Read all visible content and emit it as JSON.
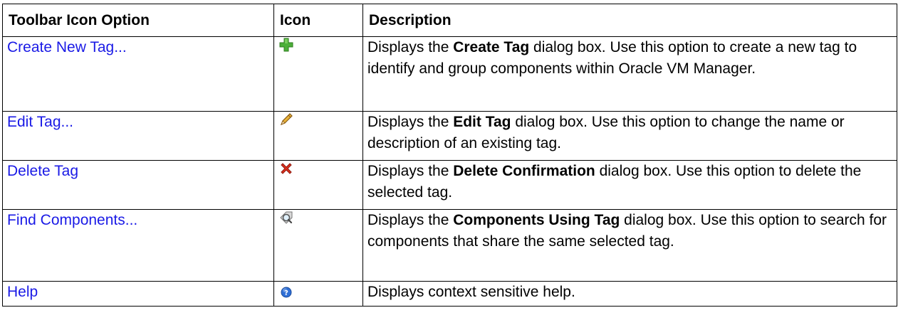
{
  "headers": {
    "option": "Toolbar Icon Option",
    "icon": "Icon",
    "description": "Description"
  },
  "rows": [
    {
      "option": "Create New Tag...",
      "icon": "add-plus-icon",
      "desc_pre": "Displays the ",
      "desc_bold": "Create Tag",
      "desc_post": " dialog box. Use this option to create a new tag to identify and group components within Oracle VM Manager."
    },
    {
      "option": "Edit Tag...",
      "icon": "pencil-icon",
      "desc_pre": "Displays the ",
      "desc_bold": "Edit Tag",
      "desc_post": " dialog box. Use this option to change the name or description of an existing tag."
    },
    {
      "option": "Delete Tag",
      "icon": "delete-x-icon",
      "desc_pre": "Displays the ",
      "desc_bold": "Delete Confirmation",
      "desc_post": " dialog box. Use this option to delete the selected tag."
    },
    {
      "option": "Find Components...",
      "icon": "find-tag-icon",
      "desc_pre": "Displays the ",
      "desc_bold": "Components Using Tag",
      "desc_post": " dialog box. Use this option to search for components that share the same selected tag."
    },
    {
      "option": "Help",
      "icon": "help-icon",
      "desc_pre": "Displays context sensitive help.",
      "desc_bold": "",
      "desc_post": ""
    }
  ],
  "colors": {
    "link": "#1a1ae6",
    "plus": "#4caf3a",
    "delete": "#e0301e",
    "help": "#2f6fd6"
  }
}
